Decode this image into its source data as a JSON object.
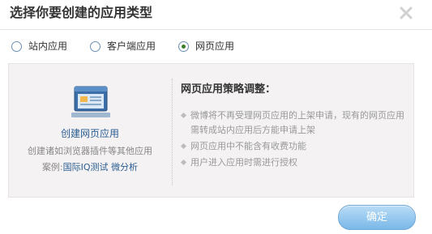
{
  "dialog": {
    "title": "选择你要创建的应用类型",
    "close_icon": "close-x-icon"
  },
  "app_types": [
    {
      "label": "站内应用",
      "selected": false
    },
    {
      "label": "客户端应用",
      "selected": false
    },
    {
      "label": "网页应用",
      "selected": true
    }
  ],
  "panel": {
    "icon": "browser-window-icon",
    "create_link": "创建网页应用",
    "description": "创建诸如浏览器插件等其他应用",
    "examples_label": "案例:",
    "examples": [
      "国际IQ测试",
      "微分析"
    ],
    "policy_title": "网页应用策略调整：",
    "rules": [
      "微博将不再受理网页应用的上架申请，现有的网页应用需转成站内应用后方能申请上架",
      "网页应用中不能含有收费功能",
      "用户进入应用时需进行授权"
    ]
  },
  "confirm_label": "确定",
  "colors": {
    "link": "#2a5d92",
    "panel_bg": "#f4f2f2",
    "button_top": "#b9dcf6",
    "button_bottom": "#7ab8e8",
    "radio_checked": "#3a7d28"
  }
}
